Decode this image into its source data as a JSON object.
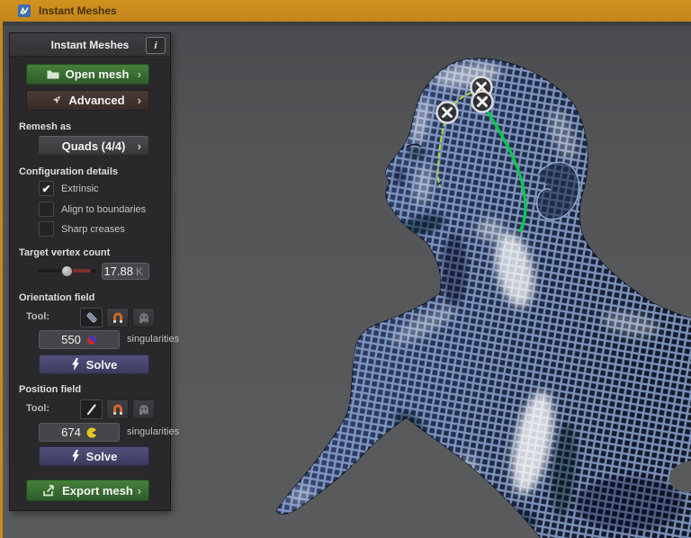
{
  "window": {
    "title": "Instant Meshes"
  },
  "panel": {
    "title": "Instant Meshes",
    "info_button": "i",
    "chevron": "›",
    "check_glyph": "✔",
    "open_mesh_label": "Open mesh",
    "advanced_label": "Advanced",
    "remesh_as_label": "Remesh as",
    "remesh_mode": "Quads (4/4)",
    "config_label": "Configuration details",
    "checkboxes": [
      {
        "label": "Extrinsic",
        "checked": true
      },
      {
        "label": "Align to boundaries",
        "checked": false
      },
      {
        "label": "Sharp creases",
        "checked": false
      }
    ],
    "target_vertex_label": "Target vertex count",
    "vertex_count": "17.88",
    "vertex_count_unit": "K",
    "orientation": {
      "label": "Orientation field",
      "tool_label": "Tool:",
      "singularities": "550",
      "singularities_label": "singularities",
      "solve_label": "Solve"
    },
    "position": {
      "label": "Position field",
      "tool_label": "Tool:",
      "singularities": "674",
      "singularities_label": "singularities",
      "solve_label": "Solve"
    },
    "export_label": "Export mesh"
  },
  "icons": {
    "app": "instant-meshes-logo",
    "open_mesh": "folder",
    "advanced": "rocket",
    "dropdown": "chevron-right",
    "orientation_tool_brush": "comb-brush",
    "position_tool_pen": "pen-stroke",
    "tool_magnet": "magnet",
    "tool_ghost": "ghost",
    "orientation_singularity": "disc-blue-red",
    "position_singularity": "disc-yellow",
    "solve": "lightning-bolt",
    "export": "export-arrow",
    "marker": "circle-x"
  },
  "viewport": {
    "stroke_markers": 3,
    "field_stroke_color": "#0ac84e",
    "guide_stroke_color": "#b8d435",
    "mesh_line_color": "#8ea6d0",
    "background_color": "#535456"
  },
  "colors": {
    "titlebar": "#c8881b",
    "panel_bg": "#29292c",
    "green_button": "#3c7a36",
    "solve_button": "#46466e",
    "slider_range": "#7c2f2c"
  }
}
